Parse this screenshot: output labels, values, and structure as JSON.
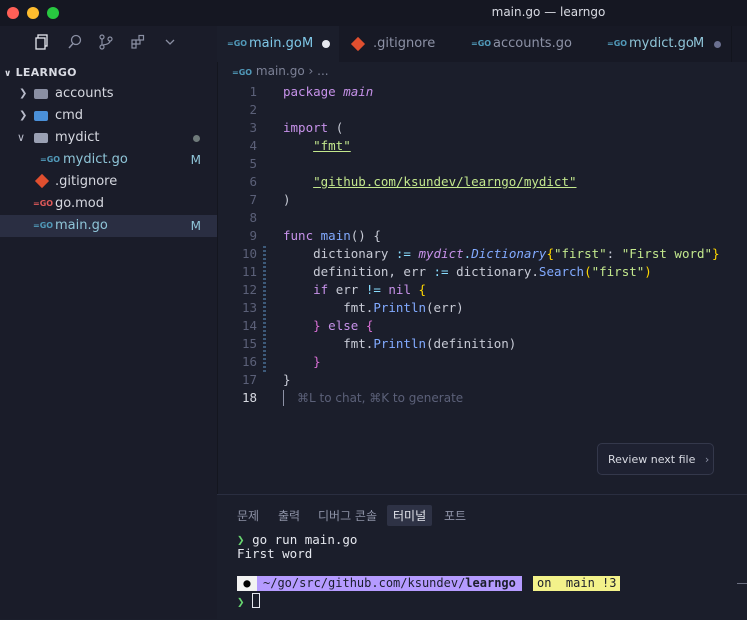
{
  "window": {
    "title": "main.go — learngo"
  },
  "sidebar": {
    "icons": [
      "files-icon",
      "search-icon",
      "source-control-icon",
      "extensions-icon",
      "chevron-down-icon"
    ],
    "header": "LEARNGO",
    "items": [
      {
        "label": "accounts",
        "kind": "folder",
        "badge": ""
      },
      {
        "label": "cmd",
        "kind": "folder",
        "badge": ""
      },
      {
        "label": "mydict",
        "kind": "folder-open",
        "badge": ""
      },
      {
        "label": "mydict.go",
        "kind": "go",
        "badge": "M"
      },
      {
        "label": ".gitignore",
        "kind": "git",
        "badge": ""
      },
      {
        "label": "go.mod",
        "kind": "gomod",
        "badge": ""
      },
      {
        "label": "main.go",
        "kind": "go",
        "badge": "M"
      }
    ]
  },
  "tabs": [
    {
      "label": "main.go",
      "badge": "M",
      "active": true
    },
    {
      "label": ".gitignore",
      "badge": "",
      "active": false
    },
    {
      "label": "accounts.go",
      "badge": "",
      "active": false
    },
    {
      "label": "mydict.go",
      "badge": "M",
      "active": false
    }
  ],
  "breadcrumb": {
    "file": "main.go",
    "symbol": "..."
  },
  "editor": {
    "line_numbers": [
      "1",
      "2",
      "3",
      "4",
      "5",
      "6",
      "7",
      "8",
      "9",
      "10",
      "11",
      "12",
      "13",
      "14",
      "15",
      "16",
      "17",
      "18"
    ],
    "current_line": "18",
    "hint": "⌘L to chat, ⌘K to generate",
    "code": {
      "l1_kw": "package",
      "l1_name": "main",
      "l3_kw": "import",
      "l3_paren": "(",
      "l4_str": "\"fmt\"",
      "l6_str": "\"github.com/ksundev/learngo/mydict\"",
      "l7": ")",
      "l9_kw": "func",
      "l9_fn": "main",
      "l9_rest": "() {",
      "l10_a": "dictionary",
      "l10_op": ":=",
      "l10_pkg": "mydict",
      "l10_dot": ".",
      "l10_type": "Dictionary",
      "l10_b1": "{",
      "l10_s1": "\"first\"",
      "l10_colon": ": ",
      "l10_s2": "\"First word\"",
      "l10_b2": "}",
      "l11_a": "definition, err",
      "l11_op": ":=",
      "l11_b": "dictionary.",
      "l11_fn": "Search",
      "l11_p1": "(",
      "l11_s": "\"first\"",
      "l11_p2": ")",
      "l12_kw": "if",
      "l12_a": "err",
      "l12_op": "!=",
      "l12_nil": "nil",
      "l12_b": "{",
      "l13_a": "fmt.",
      "l13_fn": "Println",
      "l13_b": "(err)",
      "l14_b1": "}",
      "l14_kw": "else",
      "l14_b2": "{",
      "l15_a": "fmt.",
      "l15_fn": "Println",
      "l15_b": "(definition)",
      "l16": "}",
      "l17": "}"
    }
  },
  "review_button": {
    "label": "Review next file",
    "chevron": "›"
  },
  "panel": {
    "tabs": [
      "문제",
      "출력",
      "디버그 콘솔",
      "터미널",
      "포트"
    ],
    "active_tab": "터미널",
    "terminal": {
      "prompt_symbol": "❯",
      "command": "go run main.go",
      "output": "First word",
      "path_prefix": "~/go/src/github.com/ksundev/",
      "path_dir": "learngo",
      "git_segment": "on  main !3"
    }
  },
  "colors": {
    "accent": "#7fc8e8",
    "keyword": "#c792ea",
    "string": "#c3e88d",
    "function": "#82aaff"
  }
}
